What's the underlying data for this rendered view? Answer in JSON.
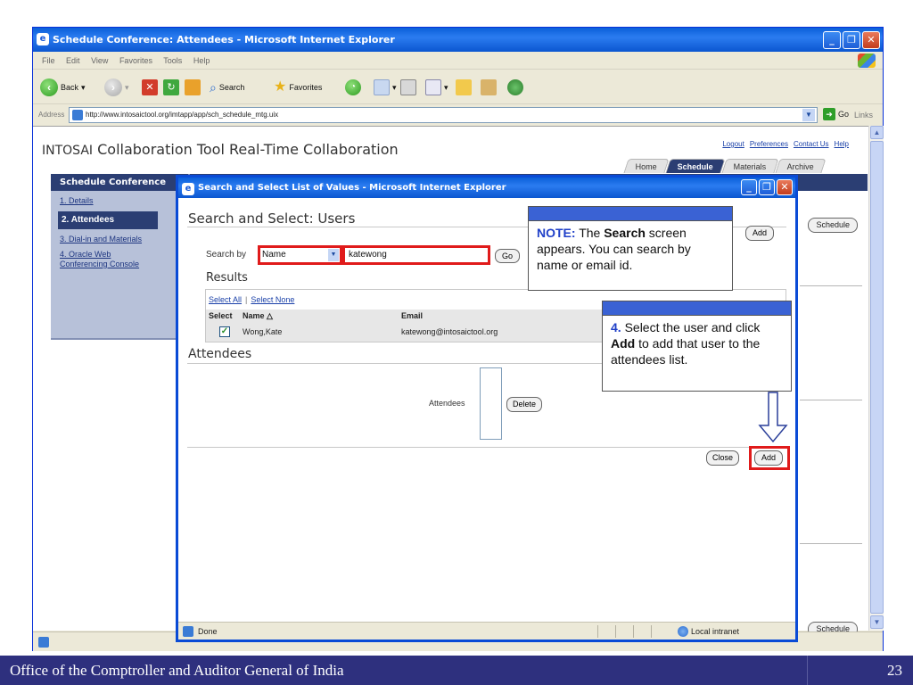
{
  "ie": {
    "title": "Schedule Conference: Attendees - Microsoft Internet Explorer",
    "menu": [
      "File",
      "Edit",
      "View",
      "Favorites",
      "Tools",
      "Help"
    ],
    "toolbar": {
      "back": "Back",
      "search": "Search",
      "favorites": "Favorites"
    },
    "address_label": "Address",
    "url": "http://www.intosaictool.org/imtapp/app/sch_schedule_mtg.uix",
    "go": "Go",
    "links": "Links",
    "window_buttons": {
      "minimize": "_",
      "maximize": "❐",
      "close": "✕"
    }
  },
  "app": {
    "title_prefix": "INTOSAI",
    "title_rest": " Collaboration Tool Real-Time Collaboration",
    "top_links": [
      "Logout",
      "Preferences",
      "Contact Us",
      "Help"
    ],
    "tabs": [
      "Home",
      "Schedule",
      "Materials",
      "Archive"
    ],
    "active_tab": "Schedule",
    "schedule_button": "Schedule"
  },
  "left_nav": {
    "header": "Schedule Conference",
    "items": [
      "1. Details",
      "2. Attendees",
      "3. Dial-in and Materials",
      "4. Oracle Web Conferencing Console"
    ],
    "active": "2. Attendees"
  },
  "popup": {
    "title": "Search and Select List of Values - Microsoft Internet Explorer",
    "heading": "Search and Select: Users",
    "search_by_label": "Search by",
    "search_by_value": "Name",
    "search_value": "katewong",
    "go": "Go",
    "results_title": "Results",
    "select_all": "Select All",
    "select_none": "Select None",
    "columns": {
      "select": "Select",
      "name": "Name △",
      "email": "Email"
    },
    "row": {
      "name": "Wong,Kate",
      "email": "katewong@intosaictool.org",
      "checked": true
    },
    "attendees_title": "Attendees",
    "attendees_label": "Attendees",
    "delete": "Delete",
    "close": "Close",
    "add": "Add",
    "status_done": "Done",
    "status_zone": "Local intranet"
  },
  "callouts": {
    "note_lead": "NOTE:",
    "note_mid1": " The ",
    "note_bold": "Search",
    "note_mid2": " screen appears. You can search by name or email id.",
    "step_num": "4.",
    "step_mid1": " Select the user and click ",
    "step_bold": "Add",
    "step_mid2": " to add that user to the attendees list."
  },
  "footer": {
    "org": "Office of the Comptroller and Auditor General of India",
    "page": "23"
  },
  "colors": {
    "slide_footer": "#2e307e",
    "app_navy": "#2b3e73",
    "highlight_red": "#e01b1b",
    "callout_bar": "#3a62d4"
  }
}
